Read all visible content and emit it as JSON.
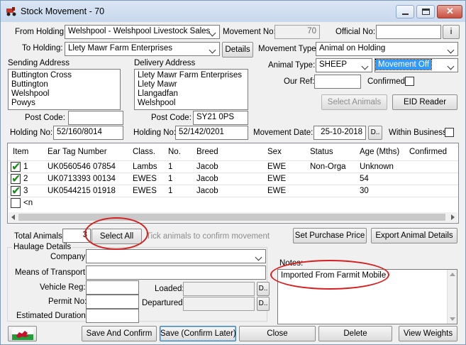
{
  "window": {
    "title": "Stock Movement - 70"
  },
  "header": {
    "from_holding_label": "From Holding:",
    "from_holding_value": "Welshpool - Welshpool Livestock Sales",
    "to_holding_label": "To Holding:",
    "to_holding_value": "Llety Mawr Farm Enterprises",
    "details_button": "Details",
    "movement_no_label": "Movement No:",
    "movement_no_value": "70",
    "official_no_label": "Official No:",
    "official_no_value": "",
    "info_button": "i",
    "movement_type_label": "Movement Type:",
    "movement_type_value": "Animal on Holding",
    "animal_type_label": "Animal Type:",
    "animal_type_value": "SHEEP",
    "movement_off_value": "Movement Off",
    "our_ref_label": "Our Ref:",
    "our_ref_value": "",
    "confirmed_label": "Confirmed:",
    "select_animals_button": "Select Animals",
    "eid_reader_button": "EID Reader"
  },
  "sending": {
    "label": "Sending Address",
    "lines": [
      "Buttington Cross",
      "Buttington",
      "Welshpool",
      "Powys"
    ],
    "postcode_label": "Post Code:",
    "postcode_value": "",
    "holding_label": "Holding No:",
    "holding_value": "52/160/8014"
  },
  "delivery": {
    "label": "Delivery Address",
    "lines": [
      "Llety Mawr Farm Enterprises",
      "Llety Mawr",
      "Llangadfan",
      "Welshpool"
    ],
    "postcode_label": "Post Code:",
    "postcode_value": "SY21 0PS",
    "holding_label": "Holding No:",
    "holding_value": "52/142/0201"
  },
  "movement_date": {
    "label": "Movement Date:",
    "value": "25-10-2018",
    "picker_button": "D.."
  },
  "within_business_label": "Within Business",
  "grid": {
    "columns": [
      "Item",
      "Ear Tag Number",
      "Class.",
      "No.",
      "Breed",
      "Sex",
      "Status",
      "Age (Mths)",
      "Confirmed"
    ],
    "rows": [
      {
        "item": "1",
        "ear_tag": "UK0560546 07854",
        "class": "Lambs",
        "no": "1",
        "breed": "Jacob",
        "sex": "EWE",
        "status": "Non-Orga",
        "age": "Unknown",
        "confirmed": ""
      },
      {
        "item": "2",
        "ear_tag": "UK0713393 00134",
        "class": "EWES",
        "no": "1",
        "breed": "Jacob",
        "sex": "EWE",
        "status": "",
        "age": "54",
        "confirmed": ""
      },
      {
        "item": "3",
        "ear_tag": "UK0544215 01918",
        "class": "EWES",
        "no": "1",
        "breed": "Jacob",
        "sex": "EWE",
        "status": "",
        "age": "30",
        "confirmed": ""
      }
    ],
    "new_row_label": "<n"
  },
  "totals": {
    "total_animals_label": "Total Animals:",
    "total_animals_value": "3",
    "select_all_button": "Select All",
    "tick_hint": "Tick animals to confirm movement",
    "set_purchase_price_button": "Set Purchase Price",
    "export_button": "Export Animal Details"
  },
  "haulage": {
    "group_label": "Haulage Details",
    "company_label": "Company:",
    "company_value": "",
    "means_label": "Means of Transport:",
    "means_value": "",
    "vehicle_reg_label": "Vehicle Reg:",
    "vehicle_reg_value": "",
    "permit_label": "Permit No:",
    "permit_value": "",
    "duration_label": "Estimated Duration:",
    "duration_value": "",
    "loaded_label": "Loaded:",
    "loaded_value": "",
    "departured_label": "Departured:",
    "departured_value": "",
    "loaded_picker": "D..",
    "departured_picker": "D.."
  },
  "notes": {
    "label": "Notes:",
    "value": "Imported From Farmit Mobile"
  },
  "footer": {
    "save_confirm_button": "Save And Confirm",
    "save_later_button": "Save (Confirm Later)",
    "close_button": "Close",
    "delete_button": "Delete",
    "view_weights_button": "View Weights"
  },
  "colors": {
    "selection_blue": "#3399ff",
    "annotation_red": "#d42020",
    "tick_green": "#1d8a1d"
  }
}
